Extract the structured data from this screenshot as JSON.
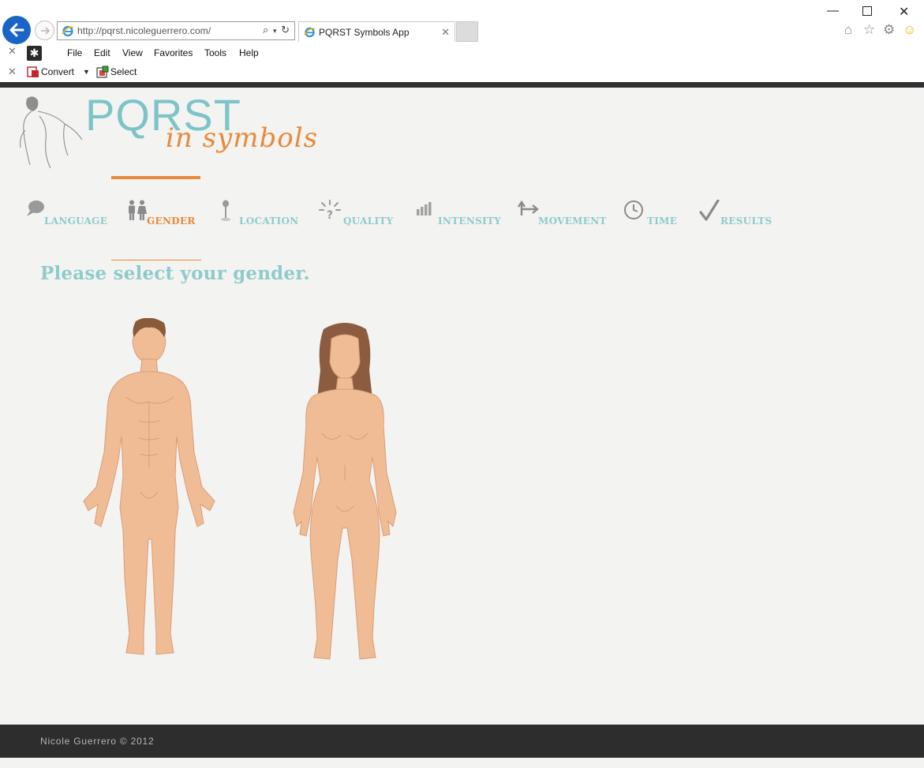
{
  "browser": {
    "url": "http://pqrst.nicoleguerrero.com/",
    "tab_title": "PQRST Symbols App",
    "menu": [
      "File",
      "Edit",
      "View",
      "Favorites",
      "Tools",
      "Help"
    ],
    "toolbar": {
      "convert_label": "Convert",
      "select_label": "Select"
    }
  },
  "app": {
    "logo_title": "PQRST",
    "logo_subtitle": "in symbols",
    "nav": [
      {
        "label": "LANGUAGE",
        "icon": "speech-bubble-icon"
      },
      {
        "label": "GENDER",
        "icon": "people-icon",
        "active": true
      },
      {
        "label": "LOCATION",
        "icon": "pin-icon"
      },
      {
        "label": "QUALITY",
        "icon": "burst-icon"
      },
      {
        "label": "INTENSITY",
        "icon": "bars-icon"
      },
      {
        "label": "MOVEMENT",
        "icon": "arrows-icon"
      },
      {
        "label": "TIME",
        "icon": "clock-icon"
      },
      {
        "label": "RESULTS",
        "icon": "checkmark-icon"
      }
    ],
    "heading": "Please select your gender.",
    "footer": "Nicole Guerrero © 2012",
    "colors": {
      "teal": "#8fcbcb",
      "orange": "#e9893a",
      "skin": "#f0bc96"
    }
  }
}
